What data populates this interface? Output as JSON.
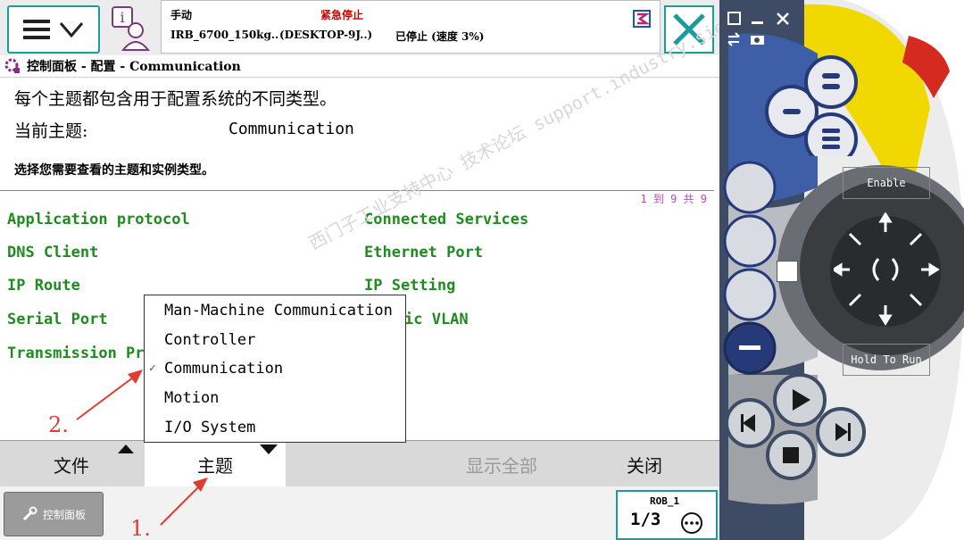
{
  "header": {
    "mode": "手动",
    "emergency": "紧急停止",
    "robot_name": "IRB_6700_150kg..",
    "host": "(DESKTOP-9J..)",
    "state": "已停止 (速度 3%)"
  },
  "breadcrumb": "控制面板 - 配置 - Communication",
  "description": "每个主题都包含用于配置系统的不同类型。",
  "current_topic_label": "当前主题:",
  "current_topic_value": "Communication",
  "instruction": "选择您需要查看的主题和实例类型。",
  "pagination": "1 到 9 共 9",
  "items_left": [
    "Application protocol",
    "DNS Client",
    "IP Route",
    "Serial Port",
    "Transmission Pr"
  ],
  "items_right": [
    "Connected Services",
    "Ethernet Port",
    "IP Setting",
    "ic VLAN"
  ],
  "topics_menu": {
    "items": [
      "Man-Machine Communication",
      "Controller",
      "Communication",
      "Motion",
      "I/O System"
    ],
    "selected": "Communication"
  },
  "bottom_bar": {
    "file": "文件",
    "topic": "主题",
    "show_all": "显示全部",
    "close": "关闭"
  },
  "taskbar": {
    "control_panel": "控制面板",
    "rob_label": "ROB_1",
    "fraction": "1/3"
  },
  "annotations": {
    "one": "1.",
    "two": "2."
  },
  "watermark": "西门子工业支持中心 技术论坛 support.industry.siemens.com/cs",
  "pendant": {
    "enable": "Enable",
    "hold_to_run": "Hold To Run"
  },
  "colors": {
    "accent": "#1a9c9c",
    "list_green": "#1e8c1e",
    "arrow_red": "#e03c31",
    "emergency_red": "#cc0000"
  }
}
